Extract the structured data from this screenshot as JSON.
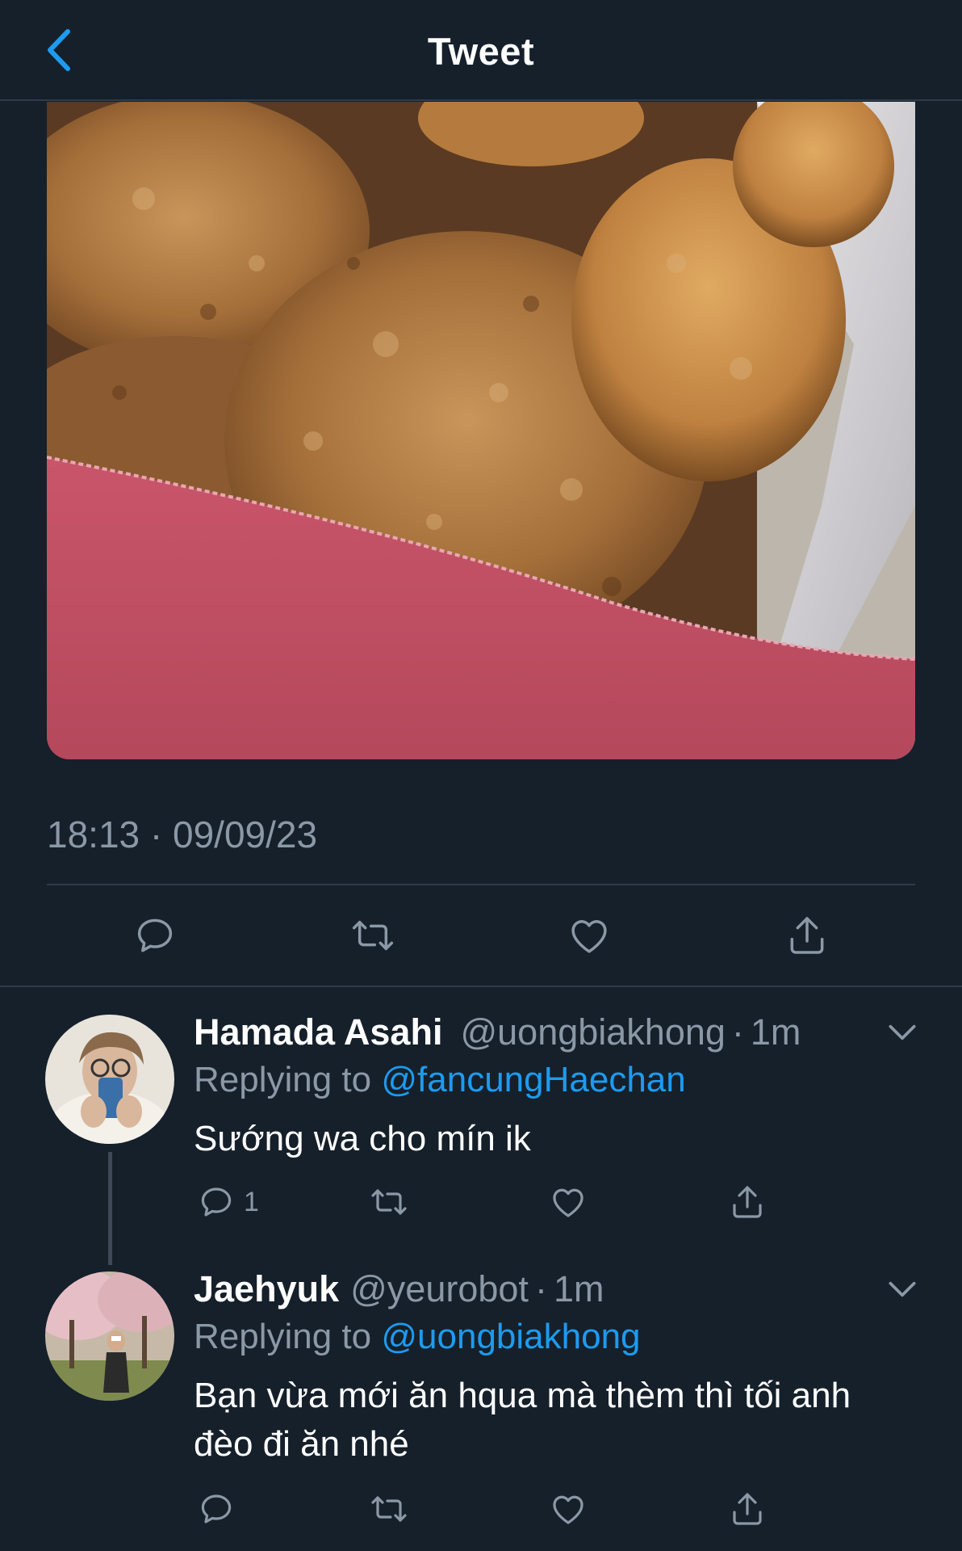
{
  "header": {
    "title": "Tweet"
  },
  "tweet": {
    "timestamp": "18:13 · 09/09/23"
  },
  "replies": [
    {
      "name": "Hamada Asahi",
      "handle": "@uongbiakhong",
      "time": "1m",
      "replying_prefix": "Replying to",
      "replying_to": "@fancungHaechan",
      "text": "Sướng wa cho mín ik",
      "reply_count": "1"
    },
    {
      "name": "Jaehyuk",
      "handle": "@yeurobot",
      "time": "1m",
      "replying_prefix": "Replying to",
      "replying_to": "@uongbiakhong",
      "text": "Bạn vừa mới ăn hqua mà thèm thì tối anh đèo đi ăn nhé",
      "reply_count": ""
    }
  ],
  "separator": "·",
  "colors": {
    "background": "#15202b",
    "accent": "#1d9bf0",
    "secondary_text": "#8b98a5",
    "divider": "#2f3b47"
  },
  "icons": [
    "back-chevron-icon",
    "reply-icon",
    "retweet-icon",
    "like-icon",
    "share-icon",
    "chevron-down-icon"
  ]
}
